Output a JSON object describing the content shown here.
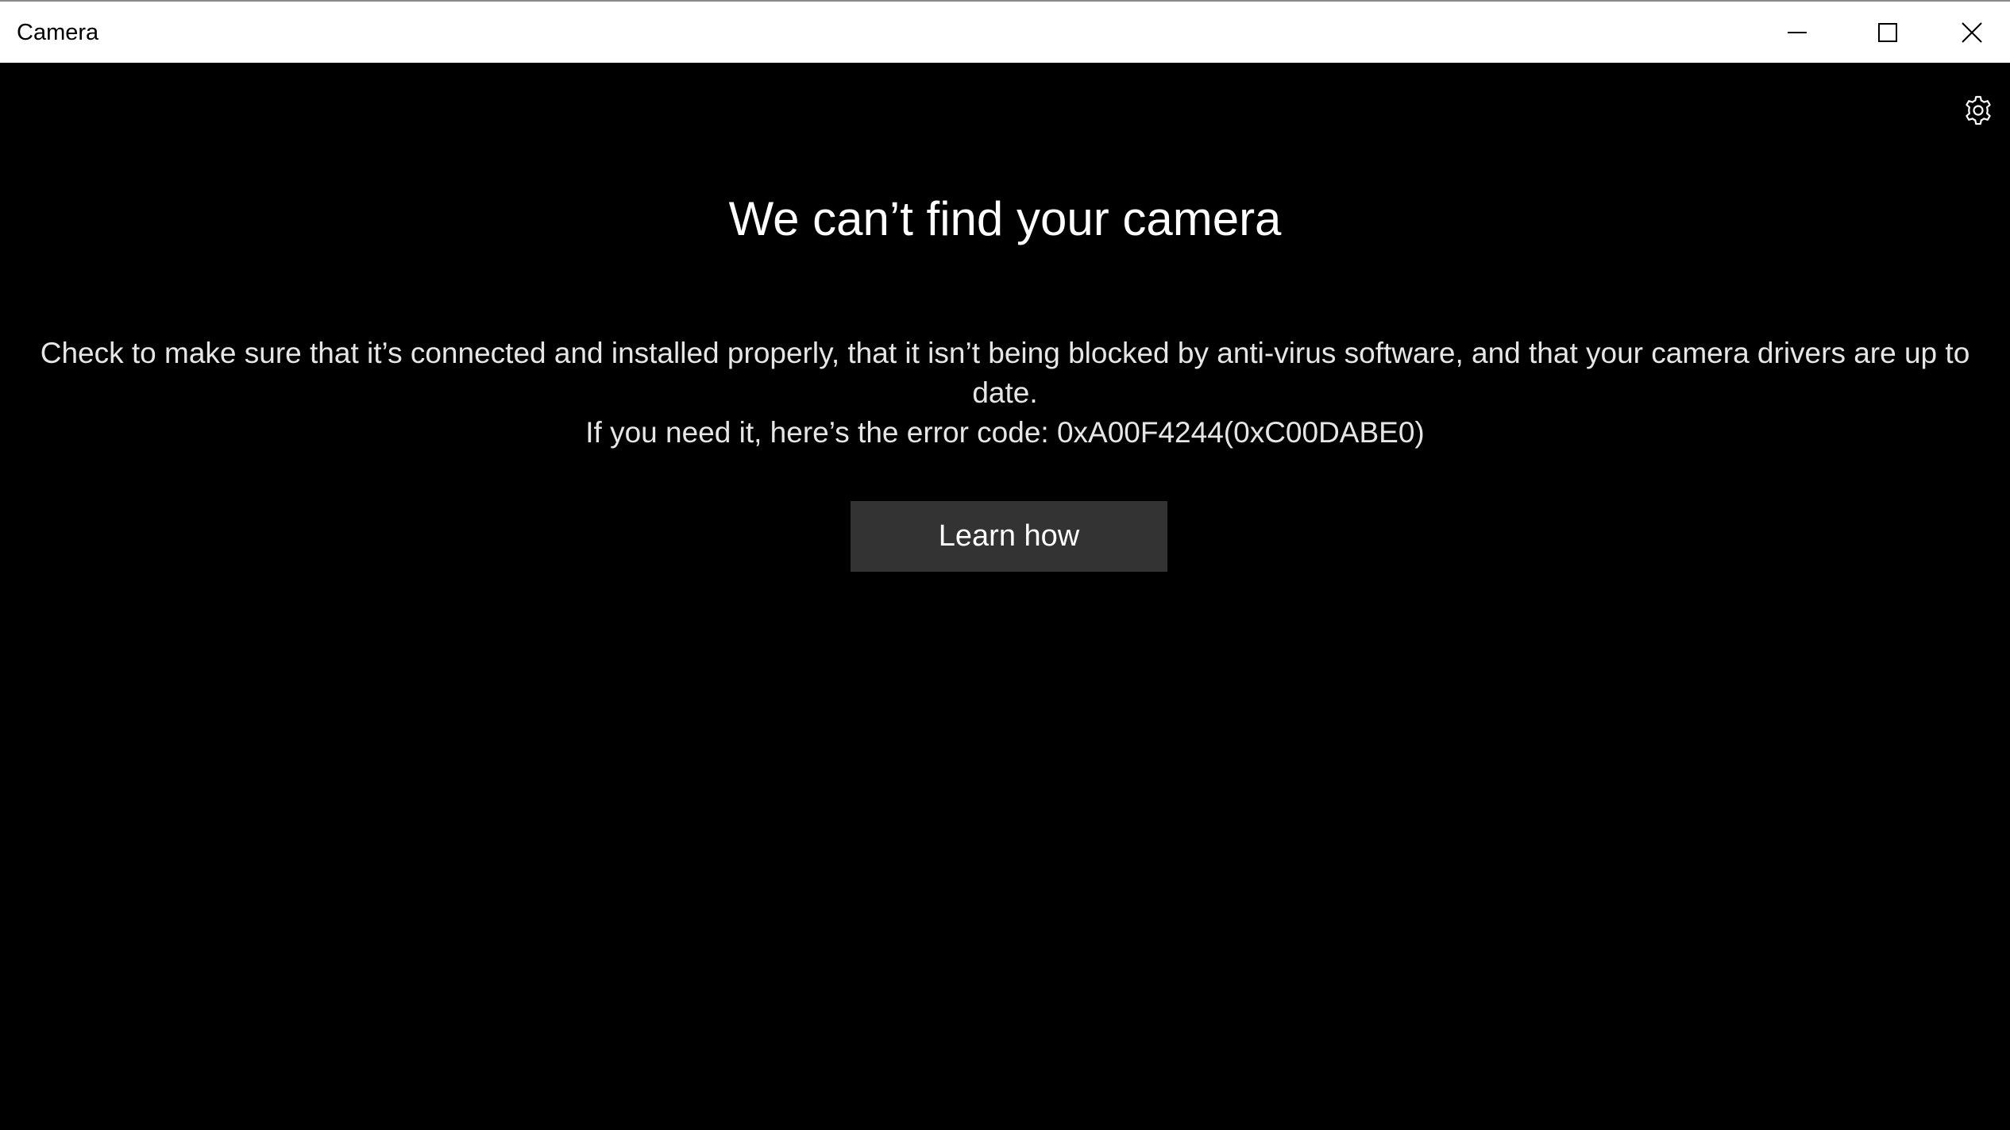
{
  "window": {
    "title": "Camera",
    "controls": {
      "minimize_icon": "minimize-icon",
      "maximize_icon": "maximize-icon",
      "close_icon": "close-icon"
    }
  },
  "toolbar": {
    "settings_icon": "gear-icon"
  },
  "error": {
    "heading": "We can’t find your camera",
    "message": "Check to make sure that it’s connected and installed properly, that it isn’t being blocked by anti-virus software, and that your camera drivers are up to date.",
    "error_code_line": "If you need it, here’s the error code: 0xA00F4244(0xC00DABE0)",
    "button_label": "Learn how"
  },
  "colors": {
    "background": "#000000",
    "titlebar": "#ffffff",
    "button": "#333333",
    "text": "#ffffff"
  }
}
